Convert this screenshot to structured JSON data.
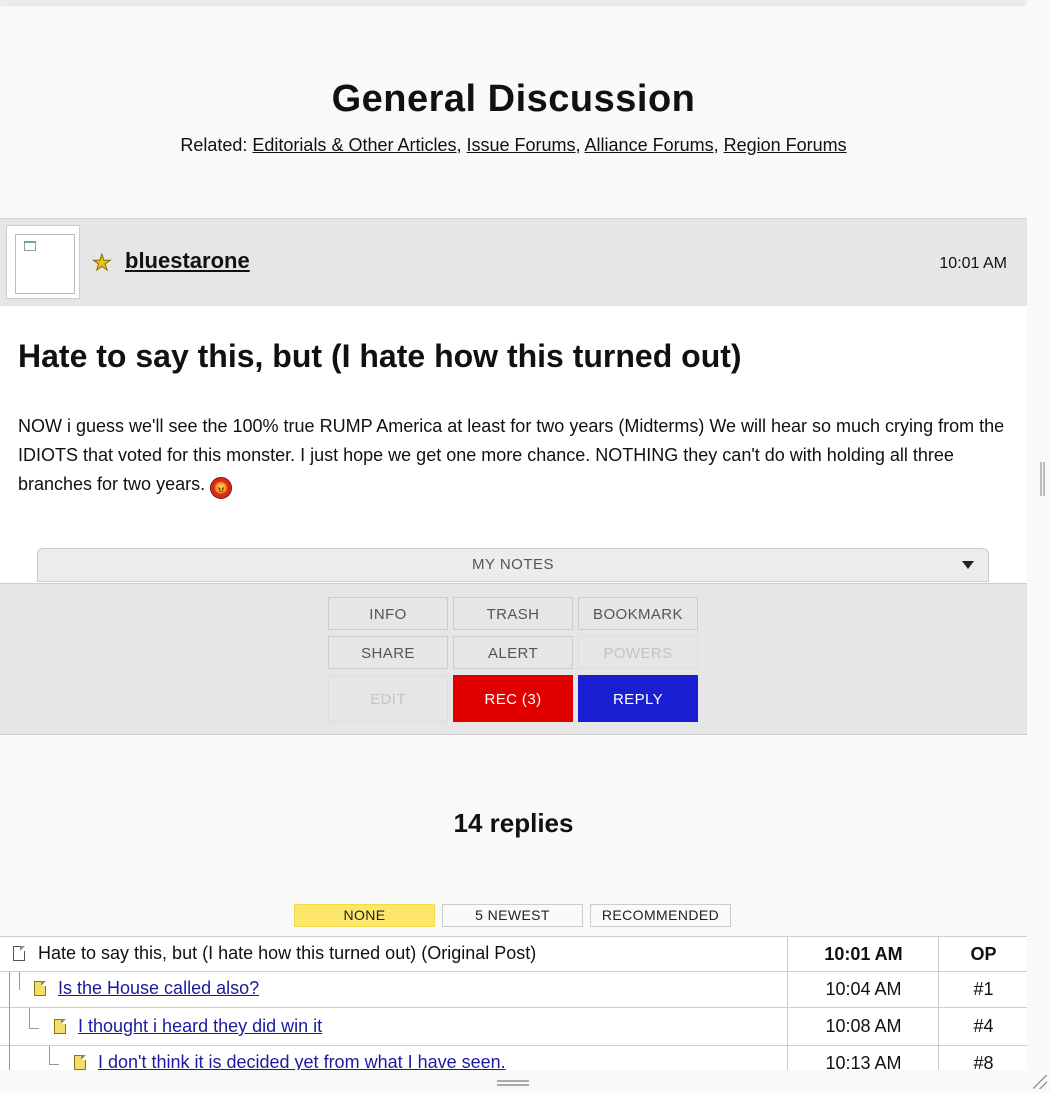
{
  "forum": {
    "title": "General Discussion",
    "related_label": "Related:",
    "related_links": [
      "Editorials & Other Articles",
      "Issue Forums",
      "Alliance Forums",
      "Region Forums"
    ]
  },
  "post": {
    "username": "bluestarone",
    "time": "10:01 AM",
    "title": "Hate to say this, but (I hate how this turned out)",
    "body": "NOW i guess we'll see the 100% true RUMP America at least for two years (Midterms) We will hear so much crying from the IDIOTS that voted for this monster. I just hope we get one more chance. NOTHING they can't do with holding all three branches for two years.",
    "emoji": "angry-face-icon"
  },
  "notes": {
    "label": "MY NOTES"
  },
  "actions": {
    "info": "INFO",
    "trash": "TRASH",
    "bookmark": "BOOKMARK",
    "share": "SHARE",
    "alert": "ALERT",
    "powers": "POWERS",
    "edit": "EDIT",
    "rec": "REC (3)",
    "reply": "REPLY",
    "colors": {
      "rec": "#e10000",
      "reply": "#1a1ed1"
    }
  },
  "replies": {
    "title": "14 replies",
    "filters": [
      "NONE",
      "5 NEWEST",
      "RECOMMENDED"
    ],
    "active_filter": "NONE",
    "rows": [
      {
        "subject": "Hate to say this, but (I hate how this turned out) (Original Post)",
        "time": "10:01 AM",
        "num": "OP"
      },
      {
        "subject": "Is the House called also?",
        "time": "10:04 AM",
        "num": "#1"
      },
      {
        "subject": "I thought i heard they did win it",
        "time": "10:08 AM",
        "num": "#4"
      },
      {
        "subject": "I don't think it is decided yet from what I have seen.",
        "time": "10:13 AM",
        "num": "#8"
      }
    ]
  }
}
